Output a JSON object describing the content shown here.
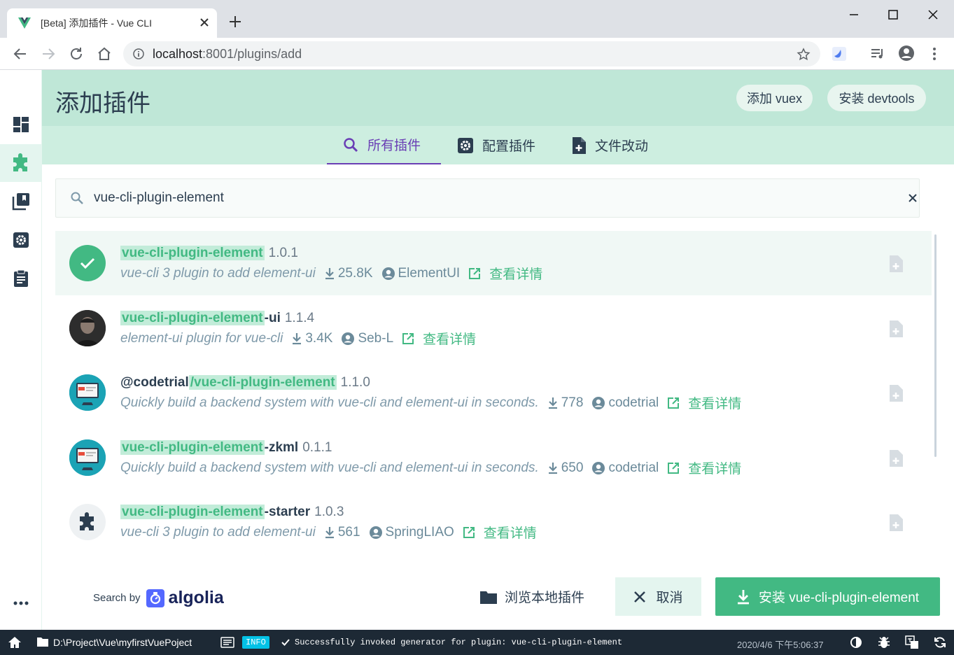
{
  "browser": {
    "tab_title": "[Beta] 添加插件 - Vue CLI",
    "url_host": "localhost",
    "url_path": ":8001/plugins/add"
  },
  "header": {
    "title": "添加插件",
    "add_vuex": "添加 vuex",
    "install_devtools": "安装 devtools"
  },
  "tabs": [
    {
      "label": "所有插件",
      "icon": "search-icon"
    },
    {
      "label": "配置插件",
      "icon": "gear-icon"
    },
    {
      "label": "文件改动",
      "icon": "file-add-icon"
    }
  ],
  "search": {
    "value": "vue-cli-plugin-element"
  },
  "plugins": [
    {
      "scope": "",
      "match": "vue-cli-plugin-element",
      "suffix": "",
      "version": "1.0.1",
      "desc": "vue-cli 3 plugin to add element-ui",
      "downloads": "25.8K",
      "author": "ElementUI",
      "detail": "查看详情"
    },
    {
      "scope": "",
      "match": "vue-cli-plugin-element",
      "suffix": "-ui",
      "version": "1.1.4",
      "desc": "element-ui plugin for vue-cli",
      "downloads": "3.4K",
      "author": "Seb-L",
      "detail": "查看详情"
    },
    {
      "scope": "@codetrial",
      "match": "/vue-cli-plugin-element",
      "suffix": "",
      "version": "1.1.0",
      "desc": "Quickly build a backend system with vue-cli and element-ui in seconds.",
      "downloads": "778",
      "author": "codetrial",
      "detail": "查看详情"
    },
    {
      "scope": "",
      "match": "vue-cli-plugin-element",
      "suffix": "-zkml",
      "version": "0.1.1",
      "desc": "Quickly build a backend system with vue-cli and element-ui in seconds.",
      "downloads": "650",
      "author": "codetrial",
      "detail": "查看详情"
    },
    {
      "scope": "",
      "match": "vue-cli-plugin-element",
      "suffix": "-starter",
      "version": "1.0.3",
      "desc": "vue-cli 3 plugin to add element-ui",
      "downloads": "561",
      "author": "SpringLIAO",
      "detail": "查看详情"
    }
  ],
  "footer": {
    "search_by": "Search by",
    "algolia": "algolia",
    "browse_local": "浏览本地插件",
    "cancel": "取消",
    "install": "安装 vue-cli-plugin-element"
  },
  "status": {
    "project_path": "D:\\Project\\Vue\\myfirstVuePoject",
    "badge": "INFO",
    "message": "Successfully invoked generator for plugin: vue-cli-plugin-element",
    "time": "2020/4/6 下午5:06:37"
  },
  "colors": {
    "accent": "#42b983",
    "header": "#bfe7d7",
    "tab_active": "#6a3fb5",
    "status_bg": "#1d2935"
  }
}
